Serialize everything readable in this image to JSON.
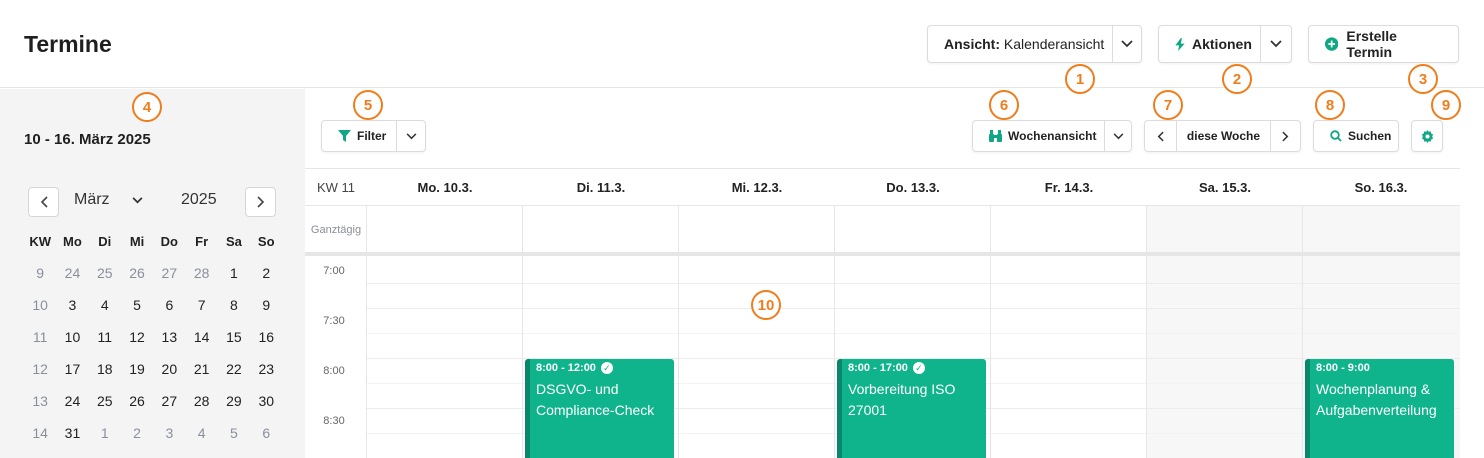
{
  "header": {
    "title": "Termine",
    "view_label": "Ansicht:",
    "view_value": "Kalenderansicht",
    "actions_label": "Aktionen",
    "create_label": "Erstelle Termin"
  },
  "markers": [
    "1",
    "2",
    "3",
    "4",
    "5",
    "6",
    "7",
    "8",
    "9",
    "10"
  ],
  "sidebar": {
    "range_title": "10 - 16. März 2025",
    "month": "März",
    "year": "2025",
    "weekday_headers": [
      "KW",
      "Mo",
      "Di",
      "Mi",
      "Do",
      "Fr",
      "Sa",
      "So"
    ],
    "weeks": [
      {
        "kw": "9",
        "days": [
          "24",
          "25",
          "26",
          "27",
          "28",
          "1",
          "2"
        ]
      },
      {
        "kw": "10",
        "days": [
          "3",
          "4",
          "5",
          "6",
          "7",
          "8",
          "9"
        ]
      },
      {
        "kw": "11",
        "days": [
          "10",
          "11",
          "12",
          "13",
          "14",
          "15",
          "16"
        ]
      },
      {
        "kw": "12",
        "days": [
          "17",
          "18",
          "19",
          "20",
          "21",
          "22",
          "23"
        ]
      },
      {
        "kw": "13",
        "days": [
          "24",
          "25",
          "26",
          "27",
          "28",
          "29",
          "30"
        ]
      },
      {
        "kw": "14",
        "days": [
          "31",
          "1",
          "2",
          "3",
          "4",
          "5",
          "6"
        ]
      }
    ]
  },
  "toolbar": {
    "filter_label": "Filter",
    "view_label": "Wochenansicht",
    "nav_label": "diese Woche",
    "search_label": "Suchen"
  },
  "grid": {
    "kw_label": "KW 11",
    "days": [
      "Mo. 10.3.",
      "Di. 11.3.",
      "Mi. 12.3.",
      "Do. 13.3.",
      "Fr. 14.3.",
      "Sa. 15.3.",
      "So. 16.3."
    ],
    "allday_label": "Ganztägig",
    "times": [
      "7:00",
      "7:30",
      "8:00",
      "8:30"
    ]
  },
  "events": [
    {
      "time": "8:00 - 12:00",
      "title": "DSGVO- und Compliance-Check",
      "confirmed": true
    },
    {
      "time": "8:00 - 17:00",
      "title": "Vorbereitung ISO 27001",
      "confirmed": true
    },
    {
      "time": "8:00 - 9:00",
      "title": "Wochenplanung & Aufgabenverteilung",
      "confirmed": false
    }
  ],
  "colors": {
    "accent": "#10a884",
    "event": "#0fb38c",
    "marker": "#f07d1c"
  }
}
